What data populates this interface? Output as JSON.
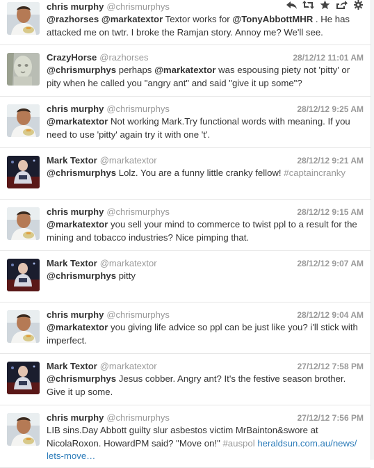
{
  "tweets": [
    {
      "name": "chris murphy",
      "handle": "@chrismurphys",
      "time": "",
      "avatar": "chris",
      "text": [
        {
          "t": "@razhorses",
          "k": "m"
        },
        {
          "t": " "
        },
        {
          "t": "@markatextor",
          "k": "m"
        },
        {
          "t": " Textor works for "
        },
        {
          "t": "@TonyAbbottMHR",
          "k": "m"
        },
        {
          "t": " . He has attacked me on twtr. I broke the Ramjan story. Annoy me? We'll see."
        }
      ]
    },
    {
      "name": "CrazyHorse",
      "handle": "@razhorses",
      "time": "28/12/12 11:01 AM",
      "avatar": "statue",
      "text": [
        {
          "t": "@chrismurphys",
          "k": "m"
        },
        {
          "t": " perhaps "
        },
        {
          "t": "@markatextor",
          "k": "m"
        },
        {
          "t": " was espousing piety not 'pitty' or pity when he called you \"angry ant\" and said \"give it up some\"?"
        }
      ]
    },
    {
      "name": "chris murphy",
      "handle": "@chrismurphys",
      "time": "28/12/12 9:25 AM",
      "avatar": "chris",
      "text": [
        {
          "t": "@markatextor",
          "k": "m"
        },
        {
          "t": " Not working Mark.Try functional words with meaning. If you need to use 'pitty' again try it with one 't'."
        }
      ]
    },
    {
      "name": "Mark Textor",
      "handle": "@markatextor",
      "time": "28/12/12 9:21 AM",
      "avatar": "mark",
      "text": [
        {
          "t": "@chrismurphys",
          "k": "m"
        },
        {
          "t": " Lolz. You are a funny little cranky fellow! "
        },
        {
          "t": "#captaincranky",
          "k": "tag"
        }
      ]
    },
    {
      "name": "chris murphy",
      "handle": "@chrismurphys",
      "time": "28/12/12 9:15 AM",
      "avatar": "chris",
      "text": [
        {
          "t": "@markatextor",
          "k": "m"
        },
        {
          "t": " you sell your mind to commerce to twist ppl to a result for the mining and tobacco industries? Nice pimping that."
        }
      ]
    },
    {
      "name": "Mark Textor",
      "handle": "@markatextor",
      "time": "28/12/12 9:07 AM",
      "avatar": "mark",
      "text": [
        {
          "t": "@chrismurphys",
          "k": "m"
        },
        {
          "t": " pitty"
        }
      ]
    },
    {
      "name": "chris murphy",
      "handle": "@chrismurphys",
      "time": "28/12/12 9:04 AM",
      "avatar": "chris",
      "text": [
        {
          "t": "@markatextor",
          "k": "m"
        },
        {
          "t": " you giving life advice so ppl can be just like you? i'll stick with imperfect."
        }
      ]
    },
    {
      "name": "Mark Textor",
      "handle": "@markatextor",
      "time": "27/12/12 7:58 PM",
      "avatar": "mark",
      "text": [
        {
          "t": "@chrismurphys",
          "k": "m"
        },
        {
          "t": " Jesus cobber. Angry ant? It's the festive season brother. Give it up some."
        }
      ]
    },
    {
      "name": "chris murphy",
      "handle": "@chrismurphys",
      "time": "27/12/12 7:56 PM",
      "avatar": "chris",
      "text": [
        {
          "t": "LIB sins.Day Abbott guilty slur asbestos victim MrBainton&swore at NicolaRoxon. HowardPM said? \"Move on!\" "
        },
        {
          "t": "#auspol",
          "k": "tag"
        },
        {
          "t": " "
        },
        {
          "t": "heraldsun.com.au/news/​lets-move…",
          "k": "link"
        }
      ]
    }
  ],
  "actions": [
    "reply-icon",
    "retweet-icon",
    "favorite-icon",
    "share-icon",
    "gear-icon"
  ]
}
